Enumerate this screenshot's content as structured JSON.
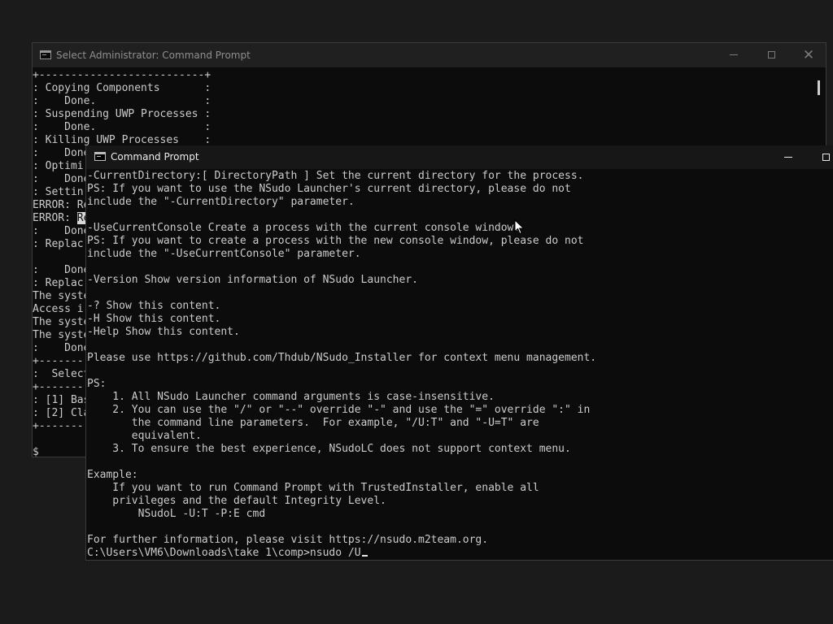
{
  "back_window": {
    "title": "Select Administrator:  Command Prompt",
    "controls": {
      "minimize": "—",
      "maximize": "□",
      "close": "✕"
    },
    "lines": [
      "+--------------------------+",
      ": Copying Components       :",
      ":    Done.                 :",
      ": Suspending UWP Processes :",
      ":    Done.                 :",
      ": Killing UWP Processes    :",
      ":    Done",
      ": Optimi",
      ":    Done",
      ": Settin",
      "ERROR: Re",
      "ERROR: ",
      ":    Done",
      ": Replac",
      "",
      ":    Done",
      ": Replac",
      "The syste",
      "Access i",
      "The syste",
      "The syste",
      ":    Done",
      "+-------",
      ":  Select",
      "+-------",
      ": [1] Bas",
      ": [2] Cla",
      "+-------",
      "",
      "$"
    ],
    "selected_text": "Re"
  },
  "front_window": {
    "title": "Command Prompt",
    "controls": {
      "minimize": "—",
      "maximize": "□"
    },
    "lines": [
      "-CurrentDirectory:[ DirectoryPath ] Set the current directory for the process.",
      "PS: If you want to use the NSudo Launcher's current directory, please do not",
      "include the \"-CurrentDirectory\" parameter.",
      "",
      "-UseCurrentConsole Create a process with the current console window.",
      "PS: If you want to create a process with the new console window, please do not",
      "include the \"-UseCurrentConsole\" parameter.",
      "",
      "-Version Show version information of NSudo Launcher.",
      "",
      "-? Show this content.",
      "-H Show this content.",
      "-Help Show this content.",
      "",
      "Please use https://github.com/Thdub/NSudo_Installer for context menu management.",
      "",
      "PS:",
      "    1. All NSudo Launcher command arguments is case-insensitive.",
      "    2. You can use the \"/\" or \"--\" override \"-\" and use the \"=\" override \":\" in",
      "       the command line parameters.  For example, \"/U:T\" and \"-U=T\" are",
      "       equivalent.",
      "    3. To ensure the best experience, NSudoLC does not support context menu.",
      "",
      "Example:",
      "    If you want to run Command Prompt with TrustedInstaller, enable all",
      "    privileges and the default Integrity Level.",
      "        NSudoL -U:T -P:E cmd",
      "",
      "For further information, please visit https://nsudo.m2team.org."
    ],
    "prompt": "C:\\Users\\VM6\\Downloads\\take 1\\comp>nsudo /U"
  }
}
